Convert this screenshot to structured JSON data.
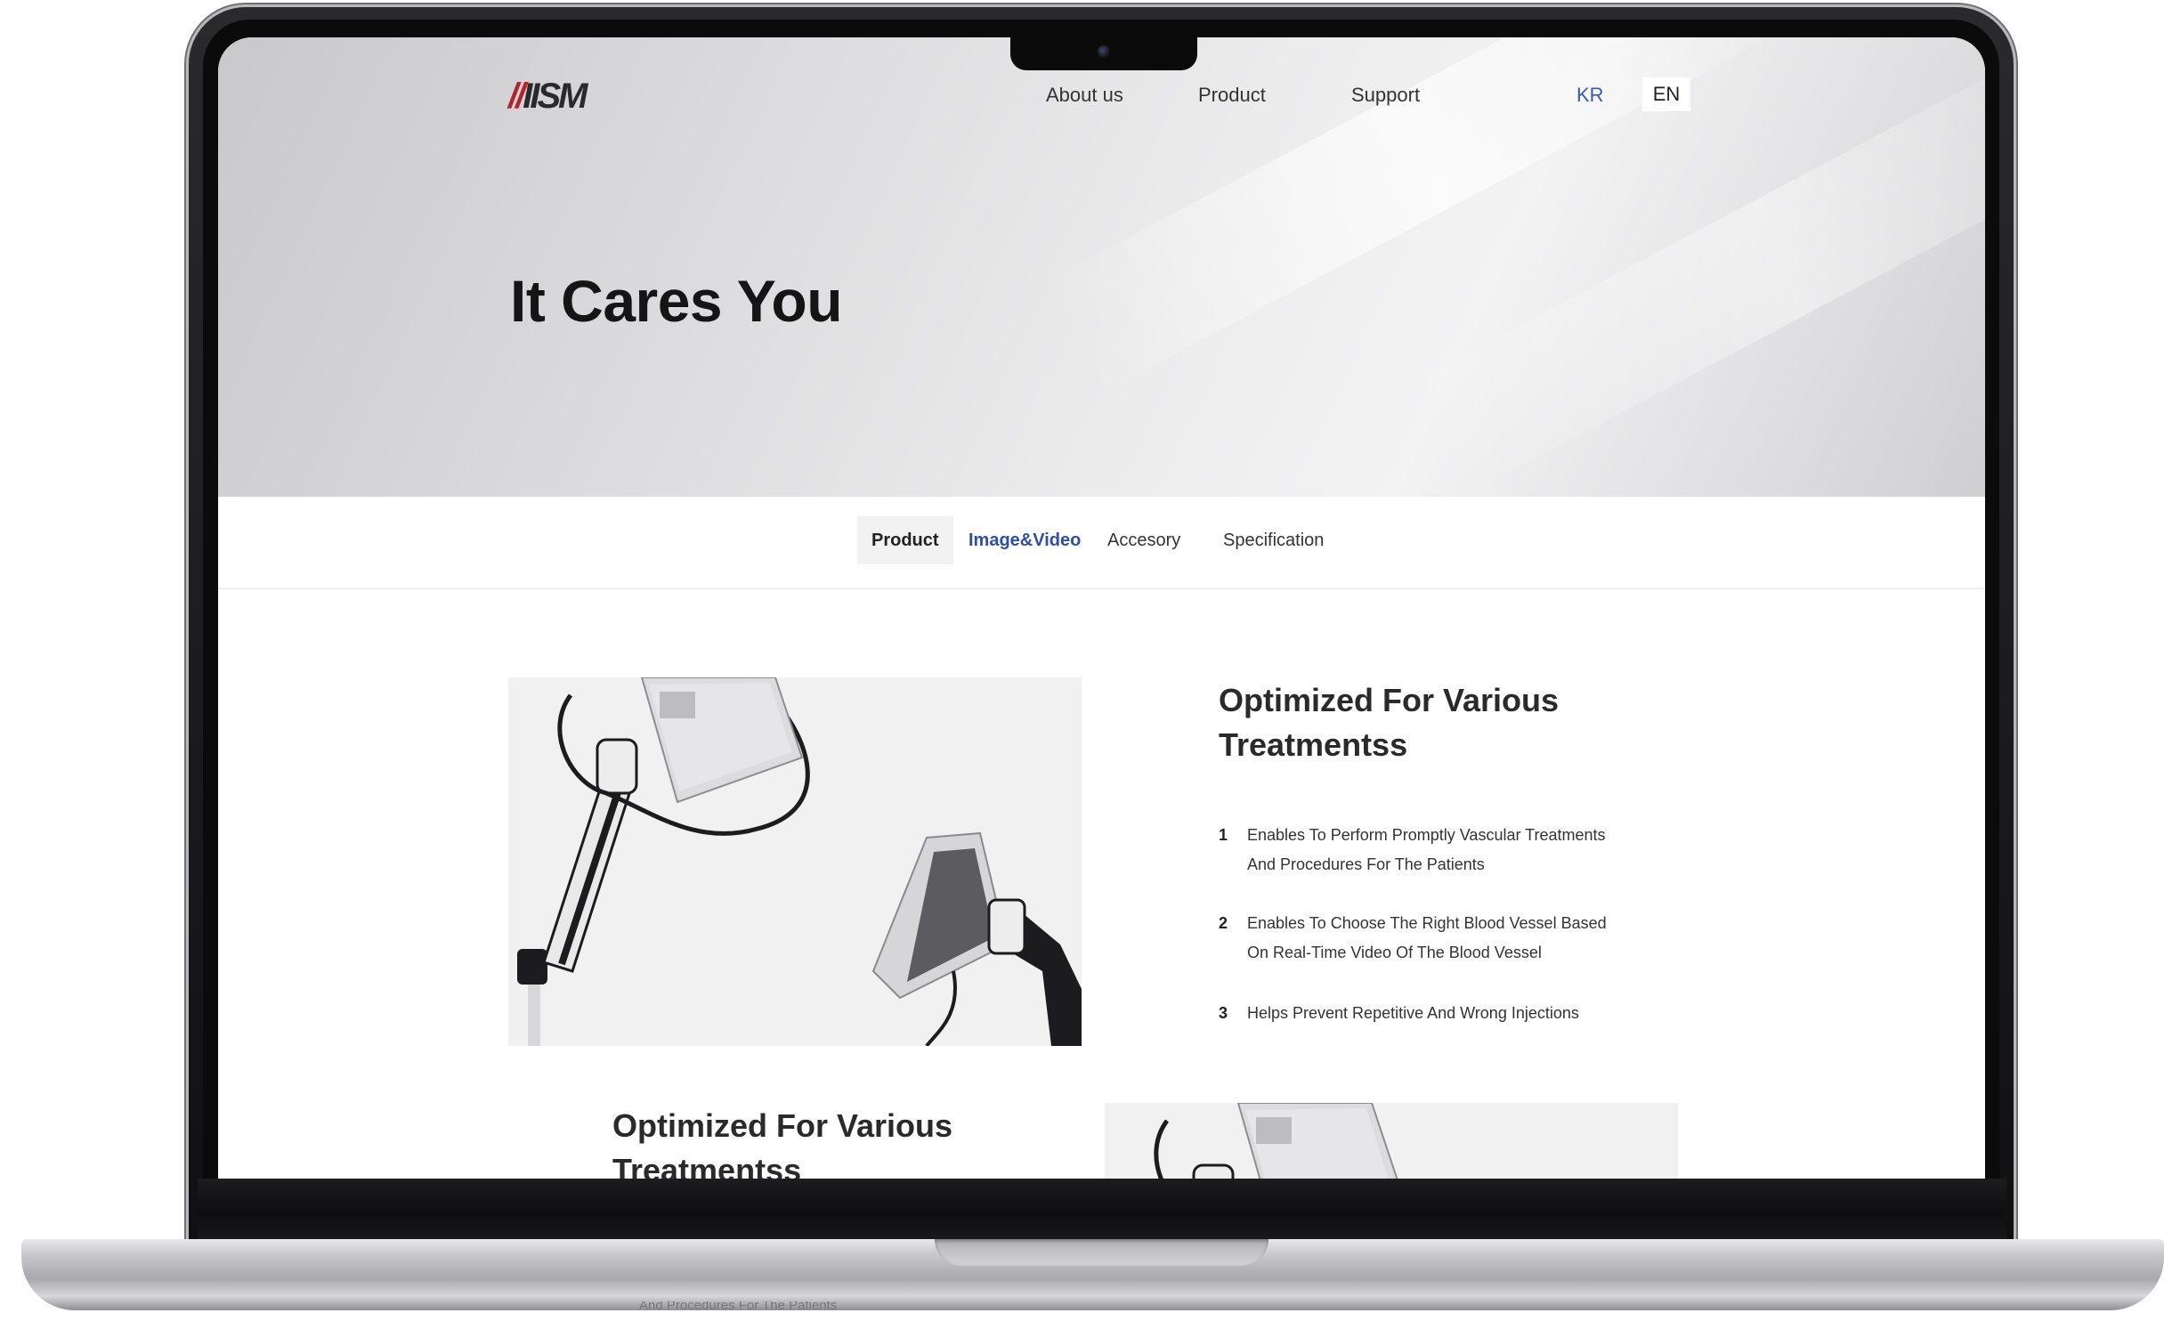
{
  "site": {
    "logo_text": "IISM",
    "nav": {
      "about": "About us",
      "product": "Product",
      "support": "Support"
    },
    "lang": {
      "kr": "KR",
      "en": "EN",
      "active": "EN"
    }
  },
  "hero": {
    "title": "It Cares You"
  },
  "tabs": [
    {
      "label": "Product"
    },
    {
      "label": "Image&Video"
    },
    {
      "label": "Accesory"
    },
    {
      "label": "Specification"
    }
  ],
  "section1": {
    "title_line1": "Optimized For Various",
    "title_line2": "Treatmentss",
    "features": [
      {
        "num": "1",
        "line1": "Enables To Perform Promptly Vascular Treatments",
        "line2": "And Procedures For The Patients"
      },
      {
        "num": "2",
        "line1": "Enables To Choose The Right Blood Vessel Based",
        "line2": "On Real-Time Video Of The Blood Vessel"
      },
      {
        "num": "3",
        "line1": "Helps Prevent Repetitive And Wrong Injections",
        "line2": ""
      }
    ]
  },
  "section2": {
    "title_line1": "Optimized For Various",
    "title_line2": "Treatmentss"
  },
  "below_fold_text": "And Procedures For The Patients",
  "colors": {
    "accent_blue": "#2e4fa8",
    "lang_kr_blue": "#3a5bb8",
    "logo_red": "#b2242a",
    "text_dark": "#151515"
  }
}
